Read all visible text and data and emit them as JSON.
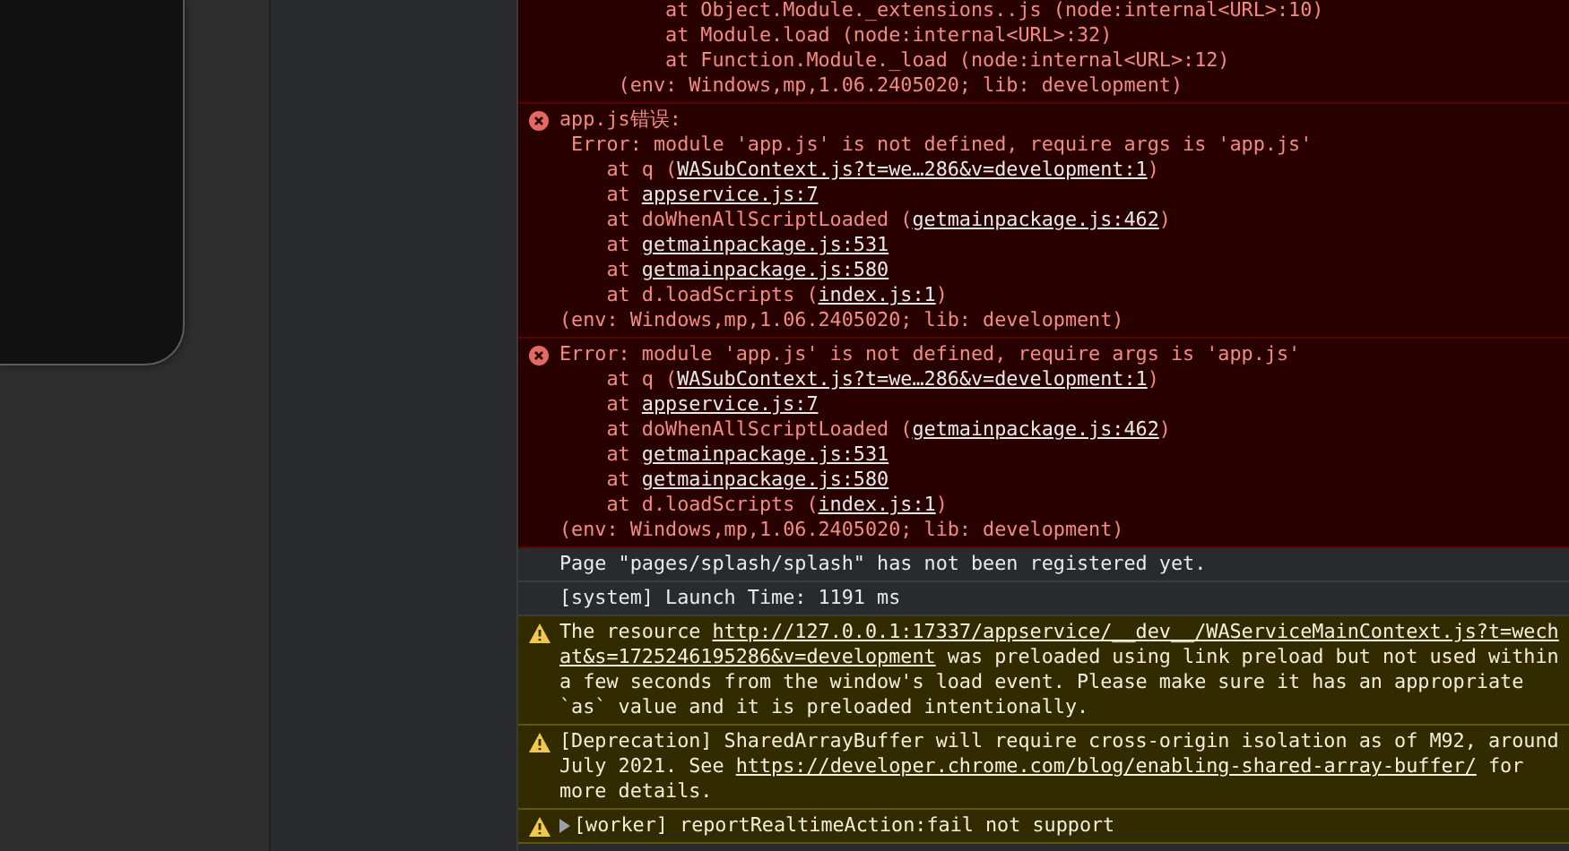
{
  "console": [
    {
      "kind": "error",
      "continued": true,
      "lines": [
        {
          "parts": [
            {
              "text": "         at Object.Module._extensions..js (node:internal<URL>:10)"
            }
          ]
        },
        {
          "parts": [
            {
              "text": "         at Module.load (node:internal<URL>:32)"
            }
          ]
        },
        {
          "parts": [
            {
              "text": "         at Function.Module._load (node:internal<URL>:12)"
            }
          ]
        },
        {
          "parts": [
            {
              "text": "     (env: Windows,mp,1.06.2405020; lib: development)"
            }
          ]
        }
      ]
    },
    {
      "kind": "error",
      "continued": false,
      "lines": [
        {
          "parts": [
            {
              "text": "app.js错误:"
            }
          ]
        },
        {
          "parts": [
            {
              "text": " Error: module 'app.js' is not defined, require args is 'app.js'"
            }
          ]
        },
        {
          "parts": [
            {
              "text": "    at q ("
            },
            {
              "link": "WASubContext.js?t=we…286&v=development:1"
            },
            {
              "text": ")"
            }
          ]
        },
        {
          "parts": [
            {
              "text": "    at "
            },
            {
              "link": "appservice.js:7"
            }
          ]
        },
        {
          "parts": [
            {
              "text": "    at doWhenAllScriptLoaded ("
            },
            {
              "link": "getmainpackage.js:462"
            },
            {
              "text": ")"
            }
          ]
        },
        {
          "parts": [
            {
              "text": "    at "
            },
            {
              "link": "getmainpackage.js:531"
            }
          ]
        },
        {
          "parts": [
            {
              "text": "    at "
            },
            {
              "link": "getmainpackage.js:580"
            }
          ]
        },
        {
          "parts": [
            {
              "text": "    at d.loadScripts ("
            },
            {
              "link": "index.js:1"
            },
            {
              "text": ")"
            }
          ]
        },
        {
          "parts": [
            {
              "text": "(env: Windows,mp,1.06.2405020; lib: development)"
            }
          ]
        }
      ]
    },
    {
      "kind": "error",
      "continued": false,
      "lines": [
        {
          "parts": [
            {
              "text": "Error: module 'app.js' is not defined, require args is 'app.js'"
            }
          ]
        },
        {
          "parts": [
            {
              "text": "    at q ("
            },
            {
              "link": "WASubContext.js?t=we…286&v=development:1"
            },
            {
              "text": ")"
            }
          ]
        },
        {
          "parts": [
            {
              "text": "    at "
            },
            {
              "link": "appservice.js:7"
            }
          ]
        },
        {
          "parts": [
            {
              "text": "    at doWhenAllScriptLoaded ("
            },
            {
              "link": "getmainpackage.js:462"
            },
            {
              "text": ")"
            }
          ]
        },
        {
          "parts": [
            {
              "text": "    at "
            },
            {
              "link": "getmainpackage.js:531"
            }
          ]
        },
        {
          "parts": [
            {
              "text": "    at "
            },
            {
              "link": "getmainpackage.js:580"
            }
          ]
        },
        {
          "parts": [
            {
              "text": "    at d.loadScripts ("
            },
            {
              "link": "index.js:1"
            },
            {
              "text": ")"
            }
          ]
        },
        {
          "parts": [
            {
              "text": "(env: Windows,mp,1.06.2405020; lib: development)"
            }
          ]
        }
      ]
    },
    {
      "kind": "info",
      "lines": [
        {
          "parts": [
            {
              "text": "Page \"pages/splash/splash\" has not been registered yet."
            }
          ]
        }
      ]
    },
    {
      "kind": "info",
      "lines": [
        {
          "parts": [
            {
              "text": "[system] Launch Time: 1191 ms"
            }
          ]
        }
      ]
    },
    {
      "kind": "warning",
      "continued": false,
      "lines": [
        {
          "parts": [
            {
              "text": "The resource "
            },
            {
              "link": "http://127.0.0.1:17337/appservice/__dev__/WAServiceMainContext.js?t=wech"
            }
          ]
        },
        {
          "parts": [
            {
              "link": "at&s=1725246195286&v=development"
            },
            {
              "text": " was preloaded using link preload but not used within"
            }
          ]
        },
        {
          "parts": [
            {
              "text": "a few seconds from the window's load event. Please make sure it has an appropriate"
            }
          ]
        },
        {
          "parts": [
            {
              "text": "`as` value and it is preloaded intentionally."
            }
          ]
        }
      ]
    },
    {
      "kind": "warning",
      "continued": false,
      "message": [
        {
          "text": "[Deprecation] SharedArrayBuffer will require cross-origin isolation as of M92, around July 2021. See "
        },
        {
          "link": "https://developer.chrome.com/blog/enabling-shared-array-buffer/"
        },
        {
          "text": " for more details."
        }
      ]
    },
    {
      "kind": "warning",
      "continued": false,
      "expanded": false,
      "message": [
        {
          "text": "[worker] reportRealtimeAction:fail not support"
        }
      ]
    }
  ]
}
